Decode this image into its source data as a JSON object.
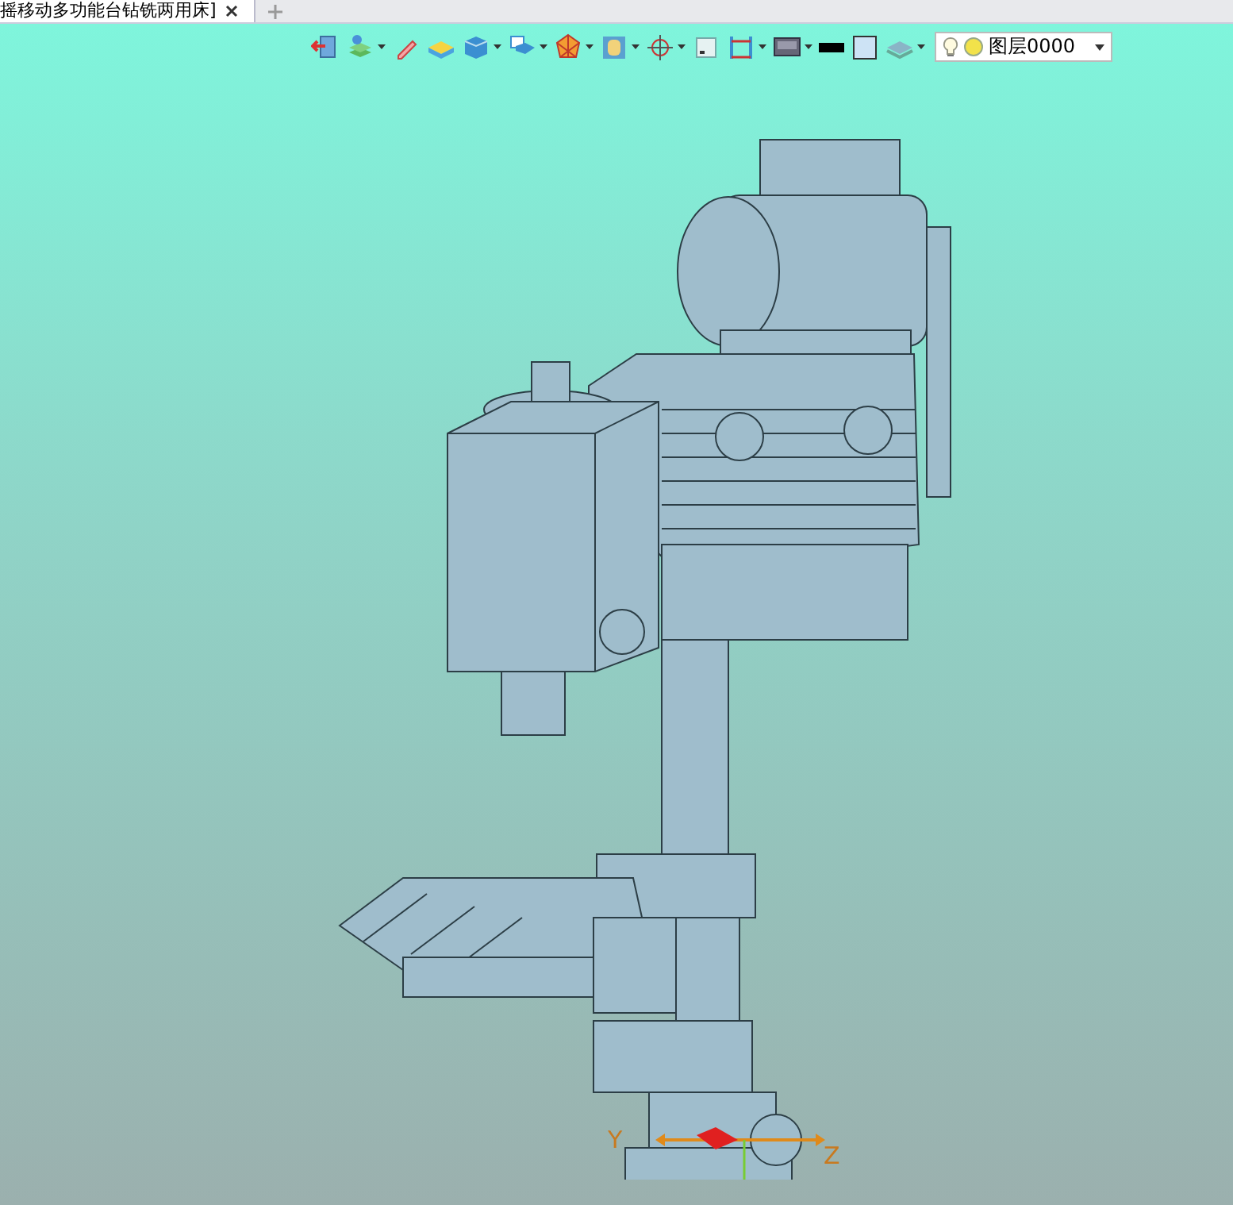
{
  "document_tab": {
    "title": "摇移动多功能台钻铣两用床]",
    "selected": true
  },
  "toolbar": [
    {
      "kind": "exit",
      "dropdown": false
    },
    {
      "kind": "layers",
      "dropdown": true
    },
    {
      "kind": "pencil",
      "dropdown": false
    },
    {
      "kind": "plane",
      "dropdown": false
    },
    {
      "kind": "cube",
      "dropdown": true
    },
    {
      "kind": "view",
      "dropdown": true
    },
    {
      "kind": "polygon",
      "dropdown": true
    },
    {
      "kind": "frame",
      "dropdown": true
    },
    {
      "kind": "crosshair",
      "dropdown": true
    },
    {
      "kind": "square",
      "dropdown": false
    },
    {
      "kind": "ruler",
      "dropdown": true
    },
    {
      "kind": "monitor",
      "dropdown": true
    },
    {
      "kind": "fill",
      "dropdown": false
    },
    {
      "kind": "outline",
      "dropdown": false
    },
    {
      "kind": "stack",
      "dropdown": true
    }
  ],
  "layer_selector": {
    "value": "图层0000"
  },
  "axes": [
    {
      "label": "Y"
    },
    {
      "label": "Z"
    }
  ]
}
